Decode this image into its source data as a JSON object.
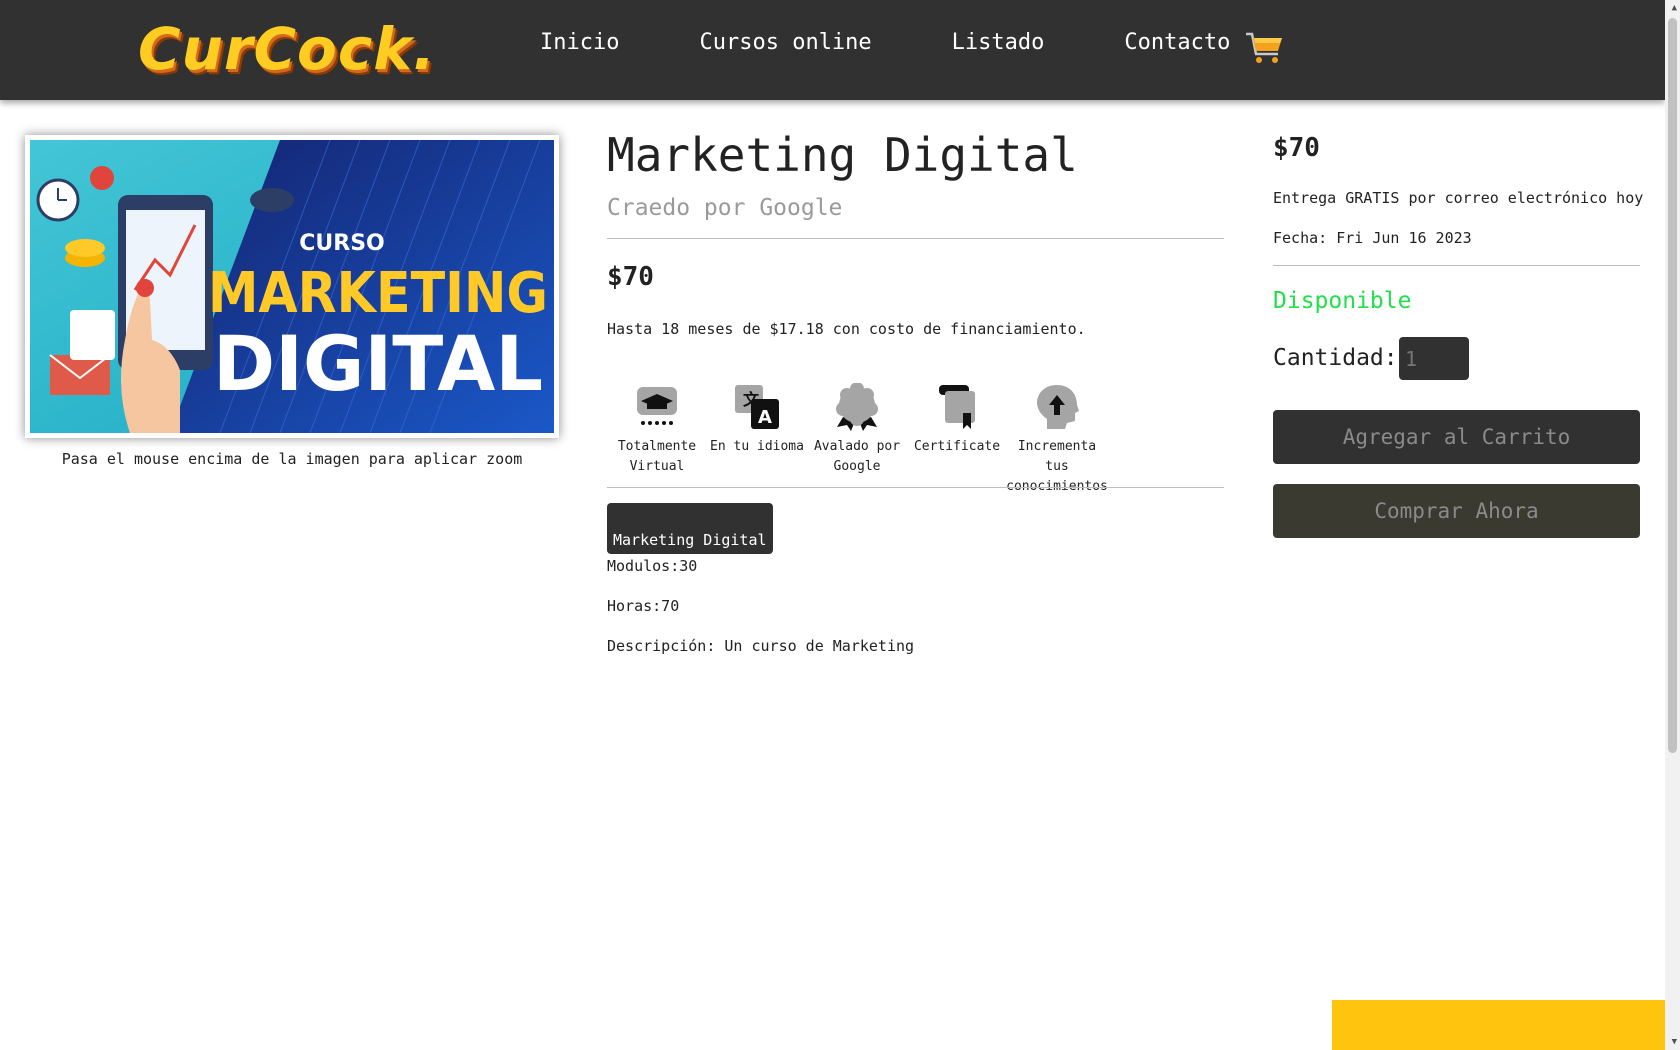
{
  "header": {
    "logo_text": "CurCock.",
    "nav": [
      "Inicio",
      "Cursos online",
      "Listado",
      "Contacto"
    ]
  },
  "image": {
    "banner_small": "CURSO",
    "banner_line1": "MARKETING",
    "banner_line2": "DIGITAL",
    "zoom_hint": "Pasa el mouse encima de la imagen para aplicar zoom"
  },
  "product": {
    "title": "Marketing Digital",
    "author": "Craedo por Google",
    "price": "$70",
    "financing": "Hasta 18 meses de $17.18 con costo de financiamiento.",
    "features": [
      {
        "icon": "graduation-cap-icon",
        "label": "Totalmente Virtual"
      },
      {
        "icon": "translate-icon",
        "label": "En tu idioma"
      },
      {
        "icon": "award-badge-icon",
        "label": "Avalado por Google"
      },
      {
        "icon": "certificate-icon",
        "label": "Certificate"
      },
      {
        "icon": "head-arrow-icon",
        "label": "Incrementa tus conocimientos"
      }
    ],
    "badge": "Marketing Digital",
    "modules": "Modulos:30",
    "hours": "Horas:70",
    "description": "Descripción: Un curso de Marketing"
  },
  "purchase": {
    "price": "$70",
    "delivery": "Entrega GRATIS por correo electrónico hoy",
    "date": "Fecha: Fri Jun 16 2023",
    "availability": "Disponible",
    "quantity_label": "Cantidad:",
    "quantity_placeholder": "1",
    "add_to_cart": "Agregar al Carrito",
    "buy_now": "Comprar Ahora"
  },
  "colors": {
    "header_bg": "#313131",
    "available": "#22e04a",
    "accent_yellow": "#fec40e"
  }
}
